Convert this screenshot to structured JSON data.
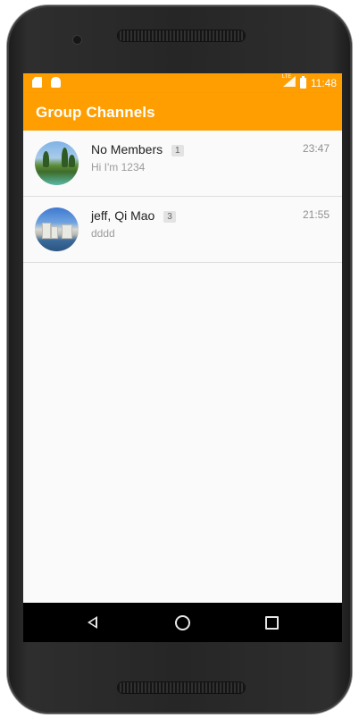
{
  "status_bar": {
    "time": "11:48",
    "network_label": "LTE"
  },
  "app_bar": {
    "title": "Group Channels"
  },
  "channels": [
    {
      "name": "No Members",
      "member_count": "1",
      "last_message": "Hi I'm 1234",
      "time": "23:47"
    },
    {
      "name": "jeff, Qi Mao",
      "member_count": "3",
      "last_message": "dddd",
      "time": "21:55"
    }
  ],
  "colors": {
    "accent": "#ff9e00",
    "background": "#fafafa",
    "nav_bar": "#000000"
  },
  "icons": {
    "status_left": [
      "sd-card-icon",
      "android-icon"
    ],
    "status_right": [
      "signal-icon",
      "battery-icon"
    ],
    "nav": [
      "back-icon",
      "home-icon",
      "recents-icon"
    ]
  }
}
